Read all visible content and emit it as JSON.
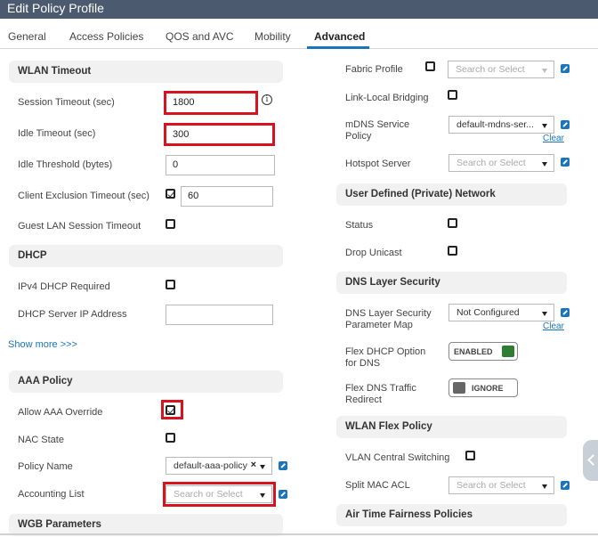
{
  "title": "Edit Policy Profile",
  "tabs": [
    "General",
    "Access Policies",
    "QOS and AVC",
    "Mobility",
    "Advanced"
  ],
  "left": {
    "wlan_timeout": {
      "heading": "WLAN Timeout",
      "session_timeout_label": "Session Timeout (sec)",
      "session_timeout_value": "1800",
      "idle_timeout_label": "Idle Timeout (sec)",
      "idle_timeout_value": "300",
      "idle_threshold_label": "Idle Threshold (bytes)",
      "idle_threshold_value": "0",
      "client_exclusion_label": "Client Exclusion Timeout (sec)",
      "client_exclusion_value": "60",
      "guest_lan_label": "Guest LAN Session Timeout"
    },
    "dhcp": {
      "heading": "DHCP",
      "ipv4_required_label": "IPv4 DHCP Required",
      "server_ip_label": "DHCP Server IP Address",
      "server_ip_value": ""
    },
    "show_more": "Show more >>>",
    "aaa": {
      "heading": "AAA Policy",
      "allow_override_label": "Allow AAA Override",
      "nac_state_label": "NAC State",
      "policy_name_label": "Policy Name",
      "policy_name_value": "default-aaa-policy",
      "accounting_list_label": "Accounting List",
      "accounting_list_placeholder": "Search or Select"
    },
    "wgb_heading": "WGB Parameters"
  },
  "right": {
    "fabric_profile_label": "Fabric Profile",
    "fabric_profile_placeholder": "Search or Select",
    "link_local_label": "Link-Local Bridging",
    "mdns_label": "mDNS Service Policy",
    "mdns_value": "default-mdns-ser...",
    "clear": "Clear",
    "hotspot_label": "Hotspot Server",
    "hotspot_placeholder": "Search or Select",
    "user_defined": {
      "heading": "User Defined (Private) Network",
      "status_label": "Status",
      "drop_unicast_label": "Drop Unicast"
    },
    "dns": {
      "heading": "DNS Layer Security",
      "param_map_label": "DNS Layer Security Parameter Map",
      "param_map_value": "Not Configured",
      "flex_dhcp_label": "Flex DHCP Option for DNS",
      "flex_dhcp_state": "ENABLED",
      "flex_dns_label": "Flex DNS Traffic Redirect",
      "flex_dns_state": "IGNORE"
    },
    "wlan_flex": {
      "heading": "WLAN Flex Policy",
      "vlan_central_label": "VLAN Central Switching",
      "split_mac_label": "Split MAC ACL",
      "split_mac_placeholder": "Search or Select"
    },
    "airtime_heading": "Air Time Fairness Policies"
  },
  "colors": {
    "titlebar": "#4b5a6e",
    "accent": "#1b75bb",
    "highlight": "#d7131f",
    "enabled": "#2e7d32",
    "ignore": "#666666"
  },
  "checkboxes": {
    "client_exclusion": true,
    "guest_lan": false,
    "ipv4_required": false,
    "allow_aaa_override": true,
    "nac_state": false,
    "fabric_profile": false,
    "link_local": false,
    "status": false,
    "drop_unicast": false,
    "vlan_central": false
  }
}
